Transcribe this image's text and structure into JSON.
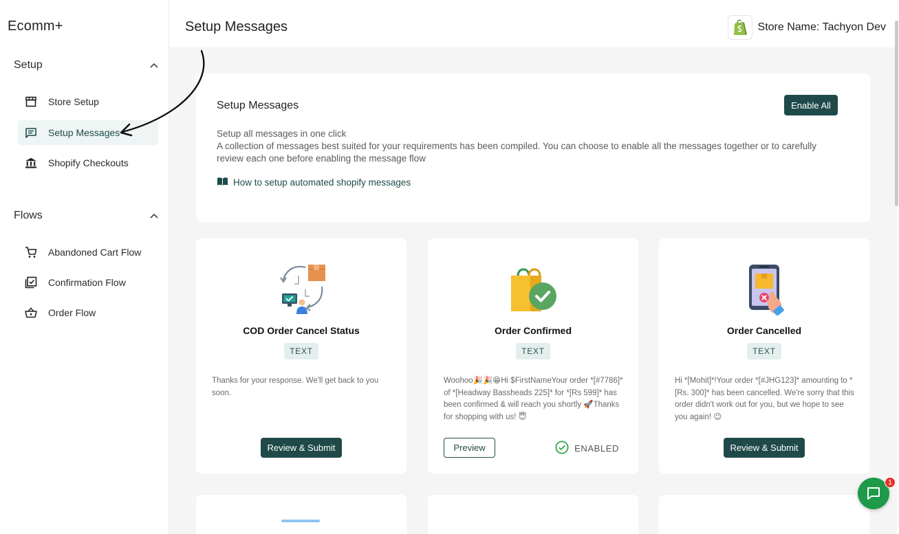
{
  "app": {
    "brand": "Ecomm+"
  },
  "header": {
    "title": "Setup Messages",
    "store_label": "Store Name: Tachyon Dev"
  },
  "sidebar": {
    "sections": [
      {
        "label": "Setup",
        "items": [
          {
            "label": "Store Setup",
            "icon": "store-icon"
          },
          {
            "label": "Setup Messages",
            "icon": "message-icon",
            "active": true
          },
          {
            "label": "Shopify Checkouts",
            "icon": "bank-icon"
          }
        ]
      },
      {
        "label": "Flows",
        "items": [
          {
            "label": "Abandoned Cart Flow",
            "icon": "cart-icon"
          },
          {
            "label": "Confirmation Flow",
            "icon": "checklist-icon"
          },
          {
            "label": "Order Flow",
            "icon": "basket-icon"
          }
        ]
      }
    ]
  },
  "intro": {
    "title": "Setup Messages",
    "enable_all": "Enable All",
    "line1": "Setup all messages in one click",
    "line2": "A collection of messages best suited for your requirements has been compiled. You can choose to enable all the messages together or to carefully review each one before enabling the message flow",
    "link": "How to setup automated shopify messages"
  },
  "cards": [
    {
      "title": "COD Order Cancel Status",
      "badge": "TEXT",
      "message": "Thanks for your response. We'll get back to you soon.",
      "action": "Review & Submit"
    },
    {
      "title": "Order Confirmed",
      "badge": "TEXT",
      "message": "Woohoo🎉🎉😁Hi $FirstNameYour order *[#7786]* of *[Headway Bassheads 225]* for *[Rs 599]* has been confirmed & will reach you shortly 🚀Thanks for shopping with us! 😇",
      "preview": "Preview",
      "status": "ENABLED"
    },
    {
      "title": "Order Cancelled",
      "badge": "TEXT",
      "message": "Hi *[Mohit]*!Your order *[#JHG123]* amounting to *[Rs. 300]* has been cancelled. We're sorry that this order didn't work out for you, but we hope to see you again! 😉",
      "action": "Review & Submit"
    }
  ],
  "chat": {
    "badge_count": "1"
  },
  "colors": {
    "accent": "#1f4a49",
    "active_bg": "#eef5f4",
    "enabled_green": "#2fa84f"
  }
}
